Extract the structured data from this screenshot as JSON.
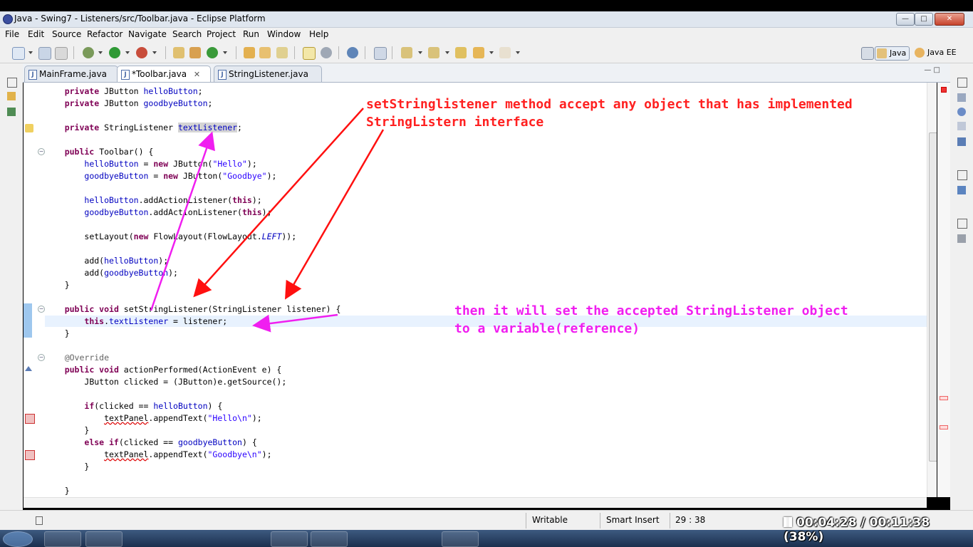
{
  "window": {
    "title": "Java - Swing7 - Listeners/src/Toolbar.java - Eclipse Platform"
  },
  "menu": [
    "File",
    "Edit",
    "Source",
    "Refactor",
    "Navigate",
    "Search",
    "Project",
    "Run",
    "Window",
    "Help"
  ],
  "perspectives": {
    "java": "Java",
    "java_ee": "Java EE"
  },
  "tabs": [
    {
      "label": "MainFrame.java",
      "active": false
    },
    {
      "label": "*Toolbar.java",
      "active": true
    },
    {
      "label": "StringListener.java",
      "active": false
    }
  ],
  "code": {
    "l01": "    private JButton ",
    "l01b": "helloButton",
    "l02": "    private JButton ",
    "l02b": "goodbyeButton",
    "l03": "    private StringListener ",
    "l03b": "textListener",
    "l04a": "    public ",
    "l04b": "Toolbar() {",
    "l05": "helloButton",
    "l05b": " = ",
    "l05c": "new",
    "l05d": " JButton(",
    "l05e": "\"Hello\"",
    "l06": "goodbyeButton",
    "l06c": "new",
    "l06d": " JButton(",
    "l06e": "\"Goodbye\"",
    "l07": "helloButton",
    "l07b": ".addActionListener(",
    "l07c": "this",
    "l08": "goodbyeButton",
    "l08b": ".addActionListener(",
    "l08c": "this",
    "l09a": "setLayout(",
    "l09b": "new",
    "l09c": " FlowLayout(FlowLayout.",
    "l09d": "LEFT",
    "l10a": "add(",
    "l10b": "helloButton",
    "l11a": "add(",
    "l11b": "goodbyeButton",
    "l13a": "public void",
    "l13b": " setStringListener(StringListener listener) {",
    "l14a": "this",
    "l14b": ".",
    "l14c": "textListener",
    "l14d": " = listener;",
    "l16": "@Override",
    "l17a": "public void",
    "l17b": " actionPerformed(ActionEvent e) {",
    "l18": "JButton clicked = (JButton)e.getSource();",
    "l19a": "if",
    "l19b": "(clicked == ",
    "l19c": "helloButton",
    "l20a": "textPanel",
    "l20b": ".appendText(",
    "l20c": "\"Hello\\n\"",
    "l22a": "else if",
    "l22b": "(clicked == ",
    "l22c": "goodbyeButton",
    "l23a": "textPanel",
    "l23b": ".appendText(",
    "l23c": "\"Goodbye\\n\""
  },
  "annotations": {
    "note1_line1": "setStringlistener method accept any object that has implemented",
    "note1_line2": "StringListern interface",
    "note2_line1": "then it will set the accepted StringListener object",
    "note2_line2": "to a variable(reference)",
    "arrow_red": "#ff1010",
    "arrow_magenta": "#f01ef0"
  },
  "status": {
    "writable": "Writable",
    "insert_mode": "Smart Insert",
    "position": "29 : 38"
  },
  "video": {
    "elapsed": "00:04:28",
    "separator": "/",
    "total": "00:11:38",
    "percent": "(38%)"
  }
}
